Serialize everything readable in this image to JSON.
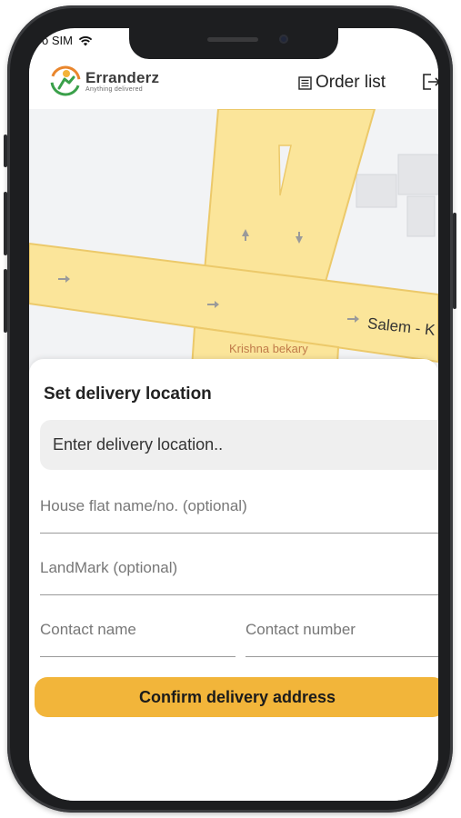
{
  "status_bar": {
    "carrier": "o SIM"
  },
  "header": {
    "logo_name": "Erranderz",
    "logo_tagline": "Anything delivered",
    "order_list_label": "Order list"
  },
  "map": {
    "place_label": "Krishna bekary",
    "road_label": "Salem - K"
  },
  "sheet": {
    "title": "Set delivery location",
    "location_placeholder": "Enter delivery location..",
    "house_placeholder": "House flat name/no. (optional)",
    "landmark_placeholder": "LandMark (optional)",
    "contact_name_placeholder": "Contact name",
    "contact_number_placeholder": "Contact number",
    "confirm_label": "Confirm delivery address"
  },
  "colors": {
    "accent": "#f2b53a",
    "road_fill": "#fbe59a",
    "road_edge": "#ecc96a",
    "map_bg": "#f2f3f5"
  }
}
